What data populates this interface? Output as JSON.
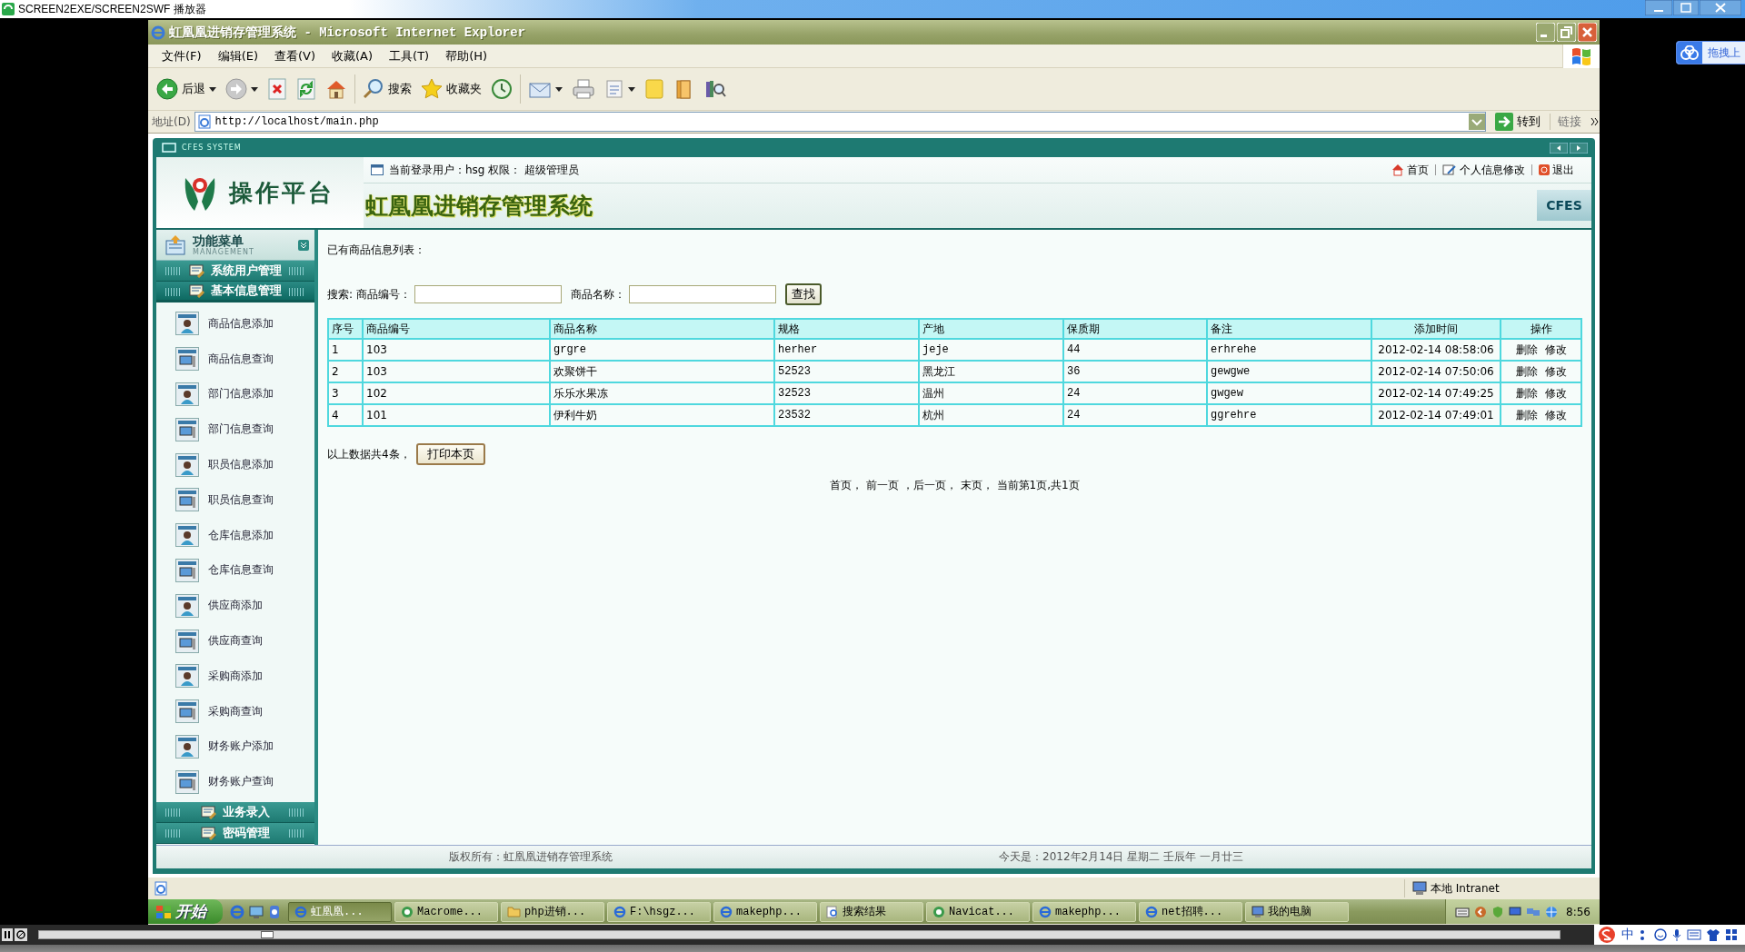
{
  "player": {
    "title": "SCREEN2EXE/SCREEN2SWF 播放器",
    "progress": {
      "level": 0.15
    }
  },
  "drag_widget": {
    "label": "拖拽上"
  },
  "window": {
    "title": "虹凰凰进销存管理系统 - Microsoft Internet Explorer"
  },
  "menu": [
    "文件(F)",
    "编辑(E)",
    "查看(V)",
    "收藏(A)",
    "工具(T)",
    "帮助(H)"
  ],
  "toolbar": [
    {
      "kind": "back",
      "label": "后退",
      "dropdown": true
    },
    {
      "kind": "forward",
      "dropdown": true
    },
    {
      "kind": "stop",
      "dropdown": false
    },
    {
      "kind": "refresh",
      "dropdown": false
    },
    {
      "kind": "home",
      "dropdown": false
    },
    {
      "kind": "search",
      "label": "搜索",
      "dropdown": false
    },
    {
      "kind": "favorites",
      "label": "收藏夹",
      "dropdown": false
    },
    {
      "kind": "history",
      "dropdown": false
    },
    {
      "kind": "mail",
      "dropdown": true
    },
    {
      "kind": "print",
      "dropdown": false
    },
    {
      "kind": "edit",
      "dropdown": true
    },
    {
      "kind": "note",
      "dropdown": false
    },
    {
      "kind": "folder",
      "dropdown": false
    },
    {
      "kind": "research",
      "dropdown": false
    }
  ],
  "address_bar": {
    "label": "地址(D)",
    "url": "http://localhost/main.php",
    "go": "转到",
    "links": "链接"
  },
  "app": {
    "system_label": "CFES SYSTEM",
    "logo": "操作平台",
    "user_info": "当前登录用户：hsg 权限： 超级管理员",
    "title": "虹凰凰进销存管理系统",
    "badge": "CFES",
    "nav": [
      {
        "kind": "home",
        "label": "首页"
      },
      {
        "kind": "edit",
        "label": "个人信息修改"
      },
      {
        "kind": "logout",
        "label": "退出"
      }
    ],
    "sidebar": {
      "title": "功能菜单",
      "subtitle": "MANAGEMENT",
      "sections": [
        {
          "label": "系统用户管理",
          "expanded": false
        },
        {
          "label": "基本信息管理",
          "expanded": true,
          "items": [
            {
              "kind": "add",
              "label": "商品信息添加"
            },
            {
              "kind": "query",
              "label": "商品信息查询"
            },
            {
              "kind": "add",
              "label": "部门信息添加"
            },
            {
              "kind": "query",
              "label": "部门信息查询"
            },
            {
              "kind": "add",
              "label": "职员信息添加"
            },
            {
              "kind": "query",
              "label": "职员信息查询"
            },
            {
              "kind": "add",
              "label": "仓库信息添加"
            },
            {
              "kind": "query",
              "label": "仓库信息查询"
            },
            {
              "kind": "add",
              "label": "供应商添加"
            },
            {
              "kind": "query",
              "label": "供应商查询"
            },
            {
              "kind": "add",
              "label": "采购商添加"
            },
            {
              "kind": "query",
              "label": "采购商查询"
            },
            {
              "kind": "add",
              "label": "财务账户添加"
            },
            {
              "kind": "query",
              "label": "财务账户查询"
            }
          ]
        },
        {
          "label": "业务录入",
          "expanded": false
        },
        {
          "label": "密码管理",
          "expanded": false
        }
      ]
    },
    "main": {
      "heading": "已有商品信息列表：",
      "search_label": "搜索:",
      "search_fields": [
        {
          "label": "商品编号："
        },
        {
          "label": "商品名称："
        }
      ],
      "search_button": "查找",
      "table": {
        "columns": [
          "序号",
          "商品编号",
          "商品名称",
          "规格",
          "产地",
          "保质期",
          "备注",
          "添加时间",
          "操作"
        ],
        "rows": [
          {
            "cells": [
              "1",
              "103",
              "grgre",
              "herher",
              "jeje",
              "44",
              "erhrehe",
              "2012-02-14 08:58:06"
            ],
            "actions": [
              "删除",
              "修改"
            ]
          },
          {
            "cells": [
              "2",
              "103",
              "欢聚饼干",
              "52523",
              "黑龙江",
              "36",
              "gewgwe",
              "2012-02-14 07:50:06"
            ],
            "actions": [
              "删除",
              "修改"
            ]
          },
          {
            "cells": [
              "3",
              "102",
              "乐乐水果冻",
              "32523",
              "温州",
              "24",
              "gwgew",
              "2012-02-14 07:49:25"
            ],
            "actions": [
              "删除",
              "修改"
            ]
          },
          {
            "cells": [
              "4",
              "101",
              "伊利牛奶",
              "23532",
              "杭州",
              "24",
              "ggrehre",
              "2012-02-14 07:49:01"
            ],
            "actions": [
              "删除",
              "修改"
            ]
          }
        ]
      },
      "summary": "以上数据共4条，",
      "print_button": "打印本页",
      "pager": "首页， 前一页 ，后一页， 末页， 当前第1页,共1页"
    },
    "footer": {
      "copyright": "版权所有：虹凰凰进销存管理系统",
      "date": "今天是：2012年2月14日 星期二 壬辰年 一月廿三"
    }
  },
  "status_bar": {
    "zone": "本地 Intranet"
  },
  "taskbar": {
    "start": "开始",
    "tasks": [
      {
        "kind": "ie",
        "label": "虹凰凰...",
        "selected": true
      },
      {
        "kind": "app",
        "label": "Macrome...",
        "selected": false
      },
      {
        "kind": "folder",
        "label": "php进销...",
        "selected": false
      },
      {
        "kind": "ie",
        "label": "F:\\hsgz...",
        "selected": false
      },
      {
        "kind": "ie",
        "label": "makephp...",
        "selected": false
      },
      {
        "kind": "search",
        "label": "搜索结果",
        "selected": false
      },
      {
        "kind": "app",
        "label": "Navicat...",
        "selected": false
      },
      {
        "kind": "ie",
        "label": "makephp...",
        "selected": false
      },
      {
        "kind": "ie",
        "label": "net招聘...",
        "selected": false
      },
      {
        "kind": "computer",
        "label": "我的电脑",
        "selected": false
      }
    ],
    "clock": "8:56"
  },
  "ime": {
    "label": "中"
  }
}
